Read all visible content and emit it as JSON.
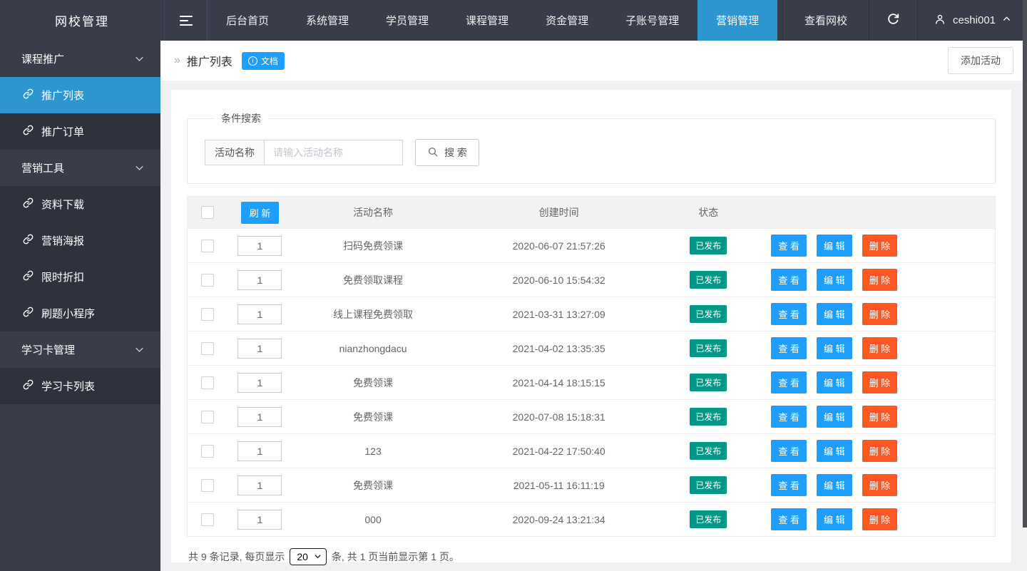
{
  "topbar": {
    "brand": "网校管理",
    "nav": [
      {
        "label": "后台首页",
        "active": false
      },
      {
        "label": "系统管理",
        "active": false
      },
      {
        "label": "学员管理",
        "active": false
      },
      {
        "label": "课程管理",
        "active": false
      },
      {
        "label": "资金管理",
        "active": false
      },
      {
        "label": "子账号管理",
        "active": false
      },
      {
        "label": "营销管理",
        "active": true
      }
    ],
    "view_school": "查看网校",
    "username": "ceshi001"
  },
  "sidebar": {
    "groups": [
      {
        "label": "课程推广",
        "items": [
          {
            "label": "推广列表",
            "active": true
          },
          {
            "label": "推广订单",
            "active": false
          }
        ]
      },
      {
        "label": "营销工具",
        "items": [
          {
            "label": "资料下载",
            "active": false
          },
          {
            "label": "营销海报",
            "active": false
          },
          {
            "label": "限时折扣",
            "active": false
          },
          {
            "label": "刷题小程序",
            "active": false
          }
        ]
      },
      {
        "label": "学习卡管理",
        "items": [
          {
            "label": "学习卡列表",
            "active": false
          }
        ]
      }
    ]
  },
  "breadcrumb": {
    "title": "推广列表",
    "doc_badge": "文档",
    "add_button": "添加活动"
  },
  "search": {
    "legend": "条件搜索",
    "label": "活动名称",
    "placeholder": "请输入活动名称",
    "button": "搜 索"
  },
  "table": {
    "refresh_button": "刷 新",
    "headers": {
      "name": "活动名称",
      "created": "创建时间",
      "status": "状态"
    },
    "actions": {
      "view": "查 看",
      "edit": "编 辑",
      "delete": "删 除"
    },
    "rows": [
      {
        "order": "1",
        "name": "扫码免费领课",
        "created": "2020-06-07 21:57:26",
        "status": "已发布"
      },
      {
        "order": "1",
        "name": "免费领取课程",
        "created": "2020-06-10 15:54:32",
        "status": "已发布"
      },
      {
        "order": "1",
        "name": "线上课程免费领取",
        "created": "2021-03-31 13:27:09",
        "status": "已发布"
      },
      {
        "order": "1",
        "name": "nianzhongdacu",
        "created": "2021-04-02 13:35:35",
        "status": "已发布"
      },
      {
        "order": "1",
        "name": "免费领课",
        "created": "2021-04-14 18:15:15",
        "status": "已发布"
      },
      {
        "order": "1",
        "name": "免费领课",
        "created": "2020-07-08 15:18:31",
        "status": "已发布"
      },
      {
        "order": "1",
        "name": "123",
        "created": "2021-04-22 17:50:40",
        "status": "已发布"
      },
      {
        "order": "1",
        "name": "免费领课",
        "created": "2021-05-11 16:11:19",
        "status": "已发布"
      },
      {
        "order": "1",
        "name": "000",
        "created": "2020-09-24 13:21:34",
        "status": "已发布"
      }
    ]
  },
  "pagination": {
    "prefix": "共 9 条记录, 每页显示",
    "per_page": "20",
    "suffix": "条, 共 1 页当前显示第 1 页。"
  },
  "colors": {
    "topbar_bg": "#393D49",
    "sidebar_leaf_bg": "#2e323d",
    "active_blue": "#2d96d1",
    "button_blue": "#1E9FFF",
    "danger_red": "#FF5722",
    "success_teal": "#009688"
  }
}
